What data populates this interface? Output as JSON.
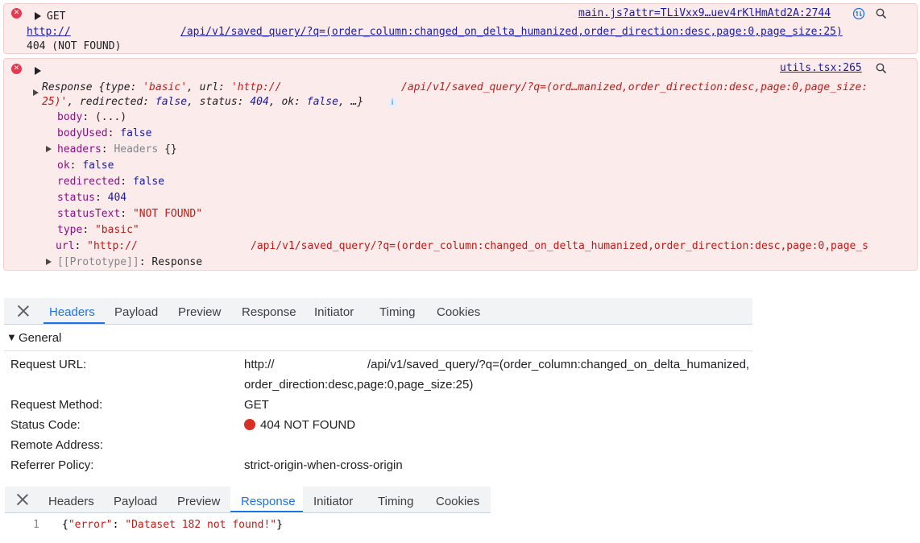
{
  "error1": {
    "method": "GET",
    "url_prefix": "http://",
    "url_path": "/api/v1/saved_query/?q=(order_column:changed_on_delta_humanized,order_direction:desc,page:0,page_size:25)",
    "status": "404 (NOT FOUND)",
    "source": "main.js?attr=TLiVxx9…uev4rKlHmAtd2A:2744"
  },
  "error2": {
    "source": "utils.tsx:265",
    "summary_line1_prefix": "Response {type: ",
    "summary_type": "'basic'",
    "summary_url_label": ", url: ",
    "summary_url_value": "'http://",
    "summary_url_path": "/api/v1/saved_query/?q=(ord…manized,order_direction:desc,page:0,page_size:",
    "summary_line2_a": "25)'",
    "summary_line2_b": ", redirected: ",
    "summary_line2_c": "false",
    "summary_line2_d": ", status: ",
    "summary_line2_e": "404",
    "summary_line2_f": ", ok: ",
    "summary_line2_g": "false",
    "summary_line2_h": ", …}",
    "info_badge": "i",
    "props": {
      "body_key": "body",
      "body_val": "(...)",
      "bodyUsed_key": "bodyUsed",
      "bodyUsed_val": "false",
      "headers_key": "headers",
      "headers_type": "Headers",
      "headers_val": "{}",
      "ok_key": "ok",
      "ok_val": "false",
      "redirected_key": "redirected",
      "redirected_val": "false",
      "status_key": "status",
      "status_val": "404",
      "statusText_key": "statusText",
      "statusText_val": "\"NOT FOUND\"",
      "type_key": "type",
      "type_val": "\"basic\"",
      "url_key": "url",
      "url_val_prefix": "\"http://",
      "url_val_path": "/api/v1/saved_query/?q=(order_column:changed_on_delta_humanized,order_direction:desc,page:0,page_s",
      "prototype_key": "[[Prototype]]",
      "prototype_val": "Response"
    }
  },
  "headers_panel": {
    "tabs": [
      "Headers",
      "Payload",
      "Preview",
      "Response",
      "Initiator",
      "Timing",
      "Cookies"
    ],
    "active_tab": "Headers",
    "section": "General",
    "rows": {
      "request_url_label": "Request URL:",
      "request_url_prefix": "http://",
      "request_url_line1": "/api/v1/saved_query/?q=(order_column:changed_on_delta_humanized,",
      "request_url_line2": "order_direction:desc,page:0,page_size:25)",
      "method_label": "Request Method:",
      "method_value": "GET",
      "status_label": "Status Code:",
      "status_value": "404 NOT FOUND",
      "remote_label": "Remote Address:",
      "referrer_label": "Referrer Policy:",
      "referrer_value": "strict-origin-when-cross-origin"
    }
  },
  "response_panel": {
    "tabs": [
      "Headers",
      "Payload",
      "Preview",
      "Response",
      "Initiator",
      "Timing",
      "Cookies"
    ],
    "active_tab": "Response",
    "line_number": "1",
    "body_open": "{",
    "body_key": "\"error\"",
    "body_colon": ": ",
    "body_value": "\"Dataset 182 not found!\"",
    "body_close": "}"
  },
  "colors": {
    "error_bg": "#fcebeb",
    "error_icon": "#e8384f",
    "accent": "#1a73e8",
    "status_dot": "#d93025"
  }
}
